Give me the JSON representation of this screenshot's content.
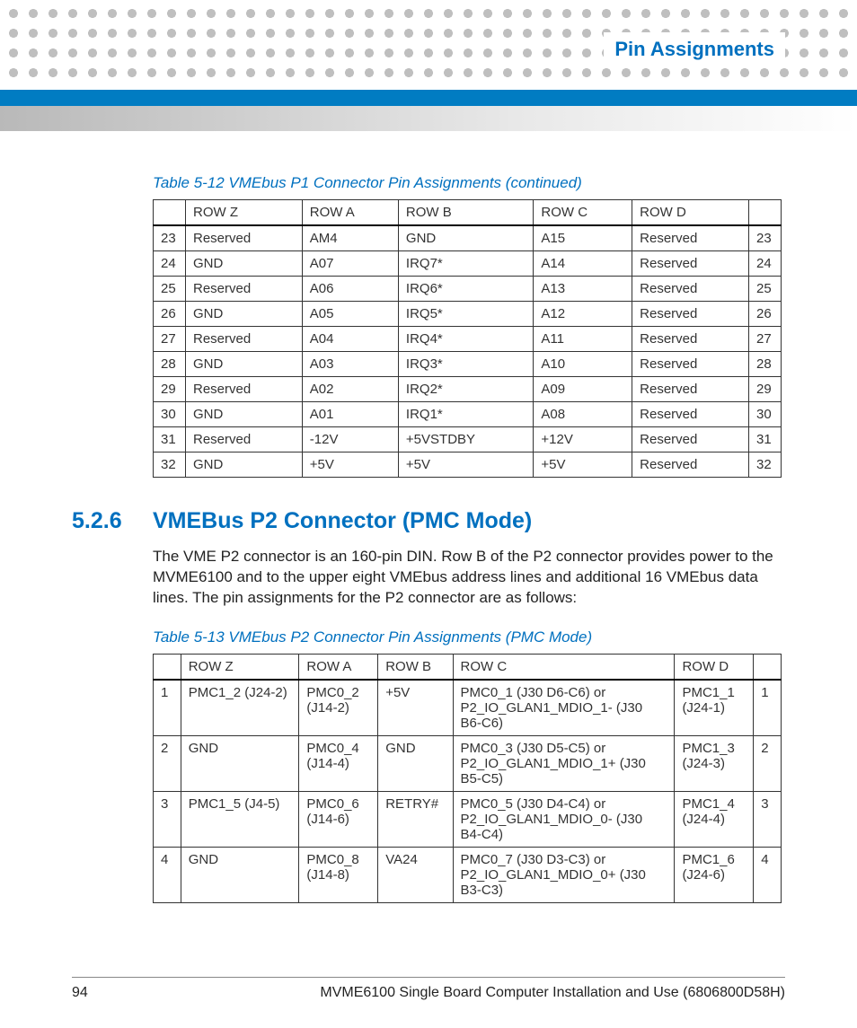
{
  "header": {
    "title": "Pin Assignments"
  },
  "table1": {
    "caption": "Table 5-12 VMEbus P1 Connector Pin Assignments (continued)",
    "headers": [
      "",
      "ROW Z",
      "ROW A",
      "ROW B",
      "ROW C",
      "ROW D",
      ""
    ],
    "rows": [
      [
        "23",
        "Reserved",
        "AM4",
        "GND",
        "A15",
        "Reserved",
        "23"
      ],
      [
        "24",
        "GND",
        "A07",
        "IRQ7*",
        "A14",
        "Reserved",
        "24"
      ],
      [
        "25",
        "Reserved",
        "A06",
        "IRQ6*",
        "A13",
        "Reserved",
        "25"
      ],
      [
        "26",
        "GND",
        "A05",
        "IRQ5*",
        "A12",
        "Reserved",
        "26"
      ],
      [
        "27",
        "Reserved",
        "A04",
        "IRQ4*",
        "A11",
        "Reserved",
        "27"
      ],
      [
        "28",
        "GND",
        "A03",
        "IRQ3*",
        "A10",
        "Reserved",
        "28"
      ],
      [
        "29",
        "Reserved",
        "A02",
        "IRQ2*",
        "A09",
        "Reserved",
        "29"
      ],
      [
        "30",
        "GND",
        "A01",
        "IRQ1*",
        "A08",
        "Reserved",
        "30"
      ],
      [
        "31",
        "Reserved",
        "-12V",
        "+5VSTDBY",
        "+12V",
        "Reserved",
        "31"
      ],
      [
        "32",
        "GND",
        "+5V",
        "+5V",
        "+5V",
        "Reserved",
        "32"
      ]
    ]
  },
  "section": {
    "number": "5.2.6",
    "title": "VMEBus P2 Connector (PMC Mode)",
    "body": "The VME P2 connector is an 160-pin DIN. Row B of the P2 connector provides power to the MVME6100 and to the upper eight VMEbus address lines and additional 16 VMEbus data lines. The pin assignments for the P2 connector are as follows:"
  },
  "table2": {
    "caption": "Table 5-13 VMEbus P2 Connector Pin Assignments (PMC Mode)",
    "headers": [
      "",
      "ROW Z",
      "ROW A",
      "ROW B",
      "ROW C",
      "ROW D",
      ""
    ],
    "rows": [
      [
        "1",
        "PMC1_2 (J24-2)",
        "PMC0_2 (J14-2)",
        "+5V",
        "PMC0_1 (J30 D6-C6) or P2_IO_GLAN1_MDIO_1- (J30 B6-C6)",
        "PMC1_1 (J24-1)",
        "1"
      ],
      [
        "2",
        "GND",
        "PMC0_4 (J14-4)",
        "GND",
        "PMC0_3 (J30 D5-C5)  or P2_IO_GLAN1_MDIO_1+ (J30 B5-C5)",
        "PMC1_3 (J24-3)",
        "2"
      ],
      [
        "3",
        "PMC1_5 (J4-5)",
        "PMC0_6 (J14-6)",
        "RETRY#",
        "PMC0_5 (J30 D4-C4) or P2_IO_GLAN1_MDIO_0- (J30 B4-C4)",
        "PMC1_4 (J24-4)",
        "3"
      ],
      [
        "4",
        "GND",
        "PMC0_8 (J14-8)",
        "VA24",
        "PMC0_7 (J30 D3-C3) or P2_IO_GLAN1_MDIO_0+ (J30 B3-C3)",
        "PMC1_6 (J24-6)",
        "4"
      ]
    ]
  },
  "footer": {
    "page": "94",
    "doc": "MVME6100 Single Board Computer Installation and Use (6806800D58H)"
  }
}
